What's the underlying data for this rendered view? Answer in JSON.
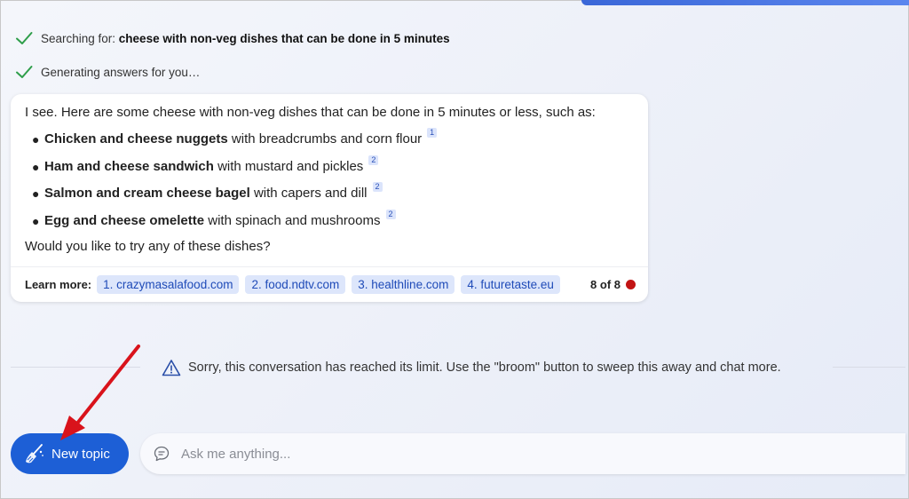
{
  "status": {
    "searching_prefix": "Searching for: ",
    "searching_query": "cheese with non-veg dishes that can be done in 5 minutes",
    "generating": "Generating answers for you…"
  },
  "answer": {
    "intro": "I see. Here are some cheese with non-veg dishes that can be done in 5 minutes or less, such as:",
    "dishes": [
      {
        "name": "Chicken and cheese nuggets",
        "desc": " with breadcrumbs and corn flour",
        "cite": "1"
      },
      {
        "name": "Ham and cheese sandwich",
        "desc": " with mustard and pickles",
        "cite": "2"
      },
      {
        "name": "Salmon and cream cheese bagel",
        "desc": " with capers and dill",
        "cite": "2"
      },
      {
        "name": "Egg and cheese omelette",
        "desc": " with spinach and mushrooms",
        "cite": "2"
      }
    ],
    "question": "Would you like to try any of these dishes?",
    "learn_more_label": "Learn more:",
    "sources": [
      "1. crazymasalafood.com",
      "2. food.ndtv.com",
      "3. healthline.com",
      "4. futuretaste.eu"
    ],
    "page_count": "8 of 8"
  },
  "limit_message": "Sorry, this conversation has reached its limit. Use the \"broom\" button to sweep this away and chat more.",
  "composer": {
    "new_topic_label": "New topic",
    "placeholder": "Ask me anything..."
  },
  "colors": {
    "accent": "#1d5fd6",
    "check": "#2e9e4a",
    "link_bg": "#dde6fb",
    "alert_red": "#c21414",
    "annotation_arrow": "#d9131b"
  },
  "icons": {
    "status": "checkmark-icon",
    "limit": "warning-triangle-icon",
    "new_topic": "broom-icon",
    "composer": "chat-bubble-icon"
  }
}
